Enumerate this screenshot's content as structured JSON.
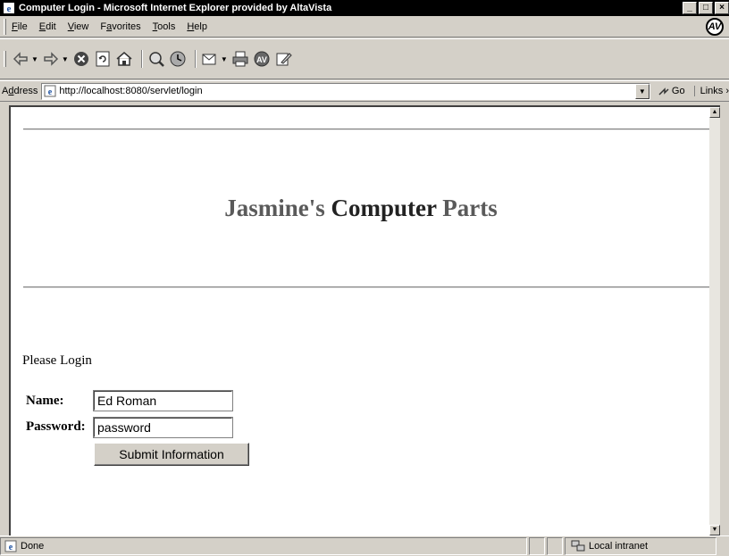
{
  "window": {
    "title": "Computer Login - Microsoft Internet Explorer provided by AltaVista",
    "minimize": "_",
    "maximize": "□",
    "close": "×"
  },
  "menu": {
    "items": [
      {
        "key": "F",
        "rest": "ile"
      },
      {
        "key": "E",
        "rest": "dit"
      },
      {
        "key": "V",
        "rest": "iew"
      },
      {
        "key": "a",
        "pre": "F",
        "rest": "vorites"
      },
      {
        "key": "T",
        "rest": "ools"
      },
      {
        "key": "H",
        "rest": "elp"
      }
    ],
    "brand_logo": "AV"
  },
  "toolbar": {
    "icons": [
      "back-icon",
      "forward-icon",
      "stop-icon",
      "refresh-icon",
      "home-icon",
      "search-icon",
      "history-icon",
      "mail-icon",
      "print-icon",
      "altavista-icon",
      "edit-icon"
    ]
  },
  "address": {
    "label_key": "d",
    "label_pre": "A",
    "label_rest": "dress",
    "url": "http://localhost:8080/servlet/login",
    "go": "Go",
    "links": "Links"
  },
  "page": {
    "heading_part1": "Jasmine's",
    "heading_part2": "Computer",
    "heading_part3": "Parts",
    "prompt": "Please Login",
    "name_label": "Name:",
    "name_value": "Ed Roman",
    "password_label": "Password:",
    "password_value": "password",
    "submit_label": "Submit Information"
  },
  "status": {
    "text": "Done",
    "zone": "Local intranet"
  },
  "colors": {
    "titlebar": "#000000",
    "chrome": "#d4d0c8",
    "heading_gray": "#5a5a5a"
  }
}
